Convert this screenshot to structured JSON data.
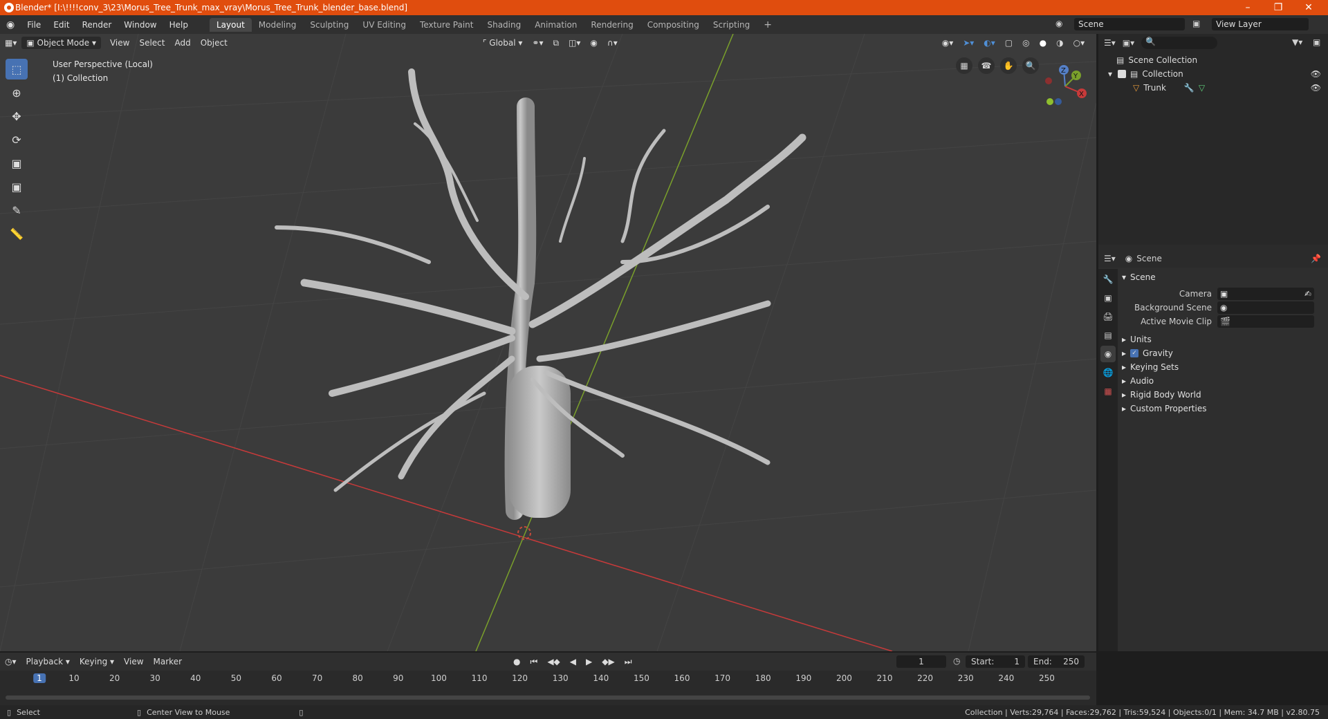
{
  "window": {
    "title": "Blender* [I:\\!!!!conv_3\\23\\Morus_Tree_Trunk_max_vray\\Morus_Tree_Trunk_blender_base.blend]"
  },
  "menubar": {
    "menus": [
      "File",
      "Edit",
      "Render",
      "Window",
      "Help"
    ],
    "workspaces": [
      "Layout",
      "Modeling",
      "Sculpting",
      "UV Editing",
      "Texture Paint",
      "Shading",
      "Animation",
      "Rendering",
      "Compositing",
      "Scripting"
    ],
    "active_workspace": "Layout",
    "scene_name": "Scene",
    "view_layer": "View Layer"
  },
  "viewport": {
    "mode": "Object Mode",
    "menus": [
      "View",
      "Select",
      "Add",
      "Object"
    ],
    "transform_orientation": "Global",
    "perspective_label": "User Perspective (Local)",
    "collection_label": "(1) Collection",
    "gizmo_axes": [
      "Z",
      "Y",
      "X"
    ]
  },
  "outliner": {
    "root": "Scene Collection",
    "collection": "Collection",
    "object": "Trunk"
  },
  "properties": {
    "context": "Scene",
    "panel": "Scene",
    "fields": [
      {
        "label": "Camera",
        "value": ""
      },
      {
        "label": "Background Scene",
        "value": ""
      },
      {
        "label": "Active Movie Clip",
        "value": ""
      }
    ],
    "sections": [
      "Units",
      "Gravity",
      "Keying Sets",
      "Audio",
      "Rigid Body World",
      "Custom Properties"
    ],
    "gravity_checked": true
  },
  "timeline": {
    "menus": [
      "Playback",
      "Keying",
      "View",
      "Marker"
    ],
    "current_frame": "1",
    "start_label": "Start:",
    "start": "1",
    "end_label": "End:",
    "end": "250",
    "ruler_ticks": [
      "1",
      "10",
      "20",
      "30",
      "40",
      "50",
      "60",
      "70",
      "80",
      "90",
      "100",
      "110",
      "120",
      "130",
      "140",
      "150",
      "160",
      "170",
      "180",
      "190",
      "200",
      "210",
      "220",
      "230",
      "240",
      "250"
    ]
  },
  "statusbar": {
    "left_action": "Select",
    "middle_action": "Center View to Mouse",
    "stats": "Collection | Verts:29,764 | Faces:29,762 | Tris:59,524 | Objects:0/1 | Mem: 34.7 MB | v2.80.75"
  },
  "colors": {
    "title_bar": "#e04d0e",
    "active_tool": "#4772b3",
    "x_axis": "#c73a3a",
    "y_axis": "#7aa02b"
  }
}
